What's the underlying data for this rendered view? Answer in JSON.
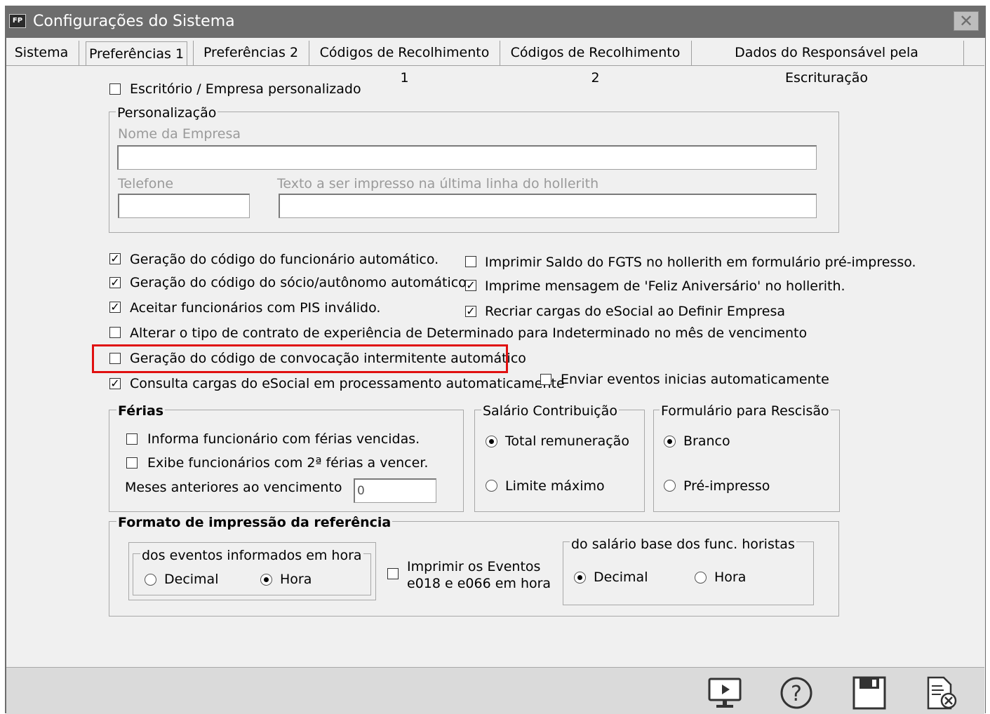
{
  "window": {
    "title": "Configurações do Sistema",
    "app_icon": "FP"
  },
  "tabs": [
    {
      "label": "Sistema"
    },
    {
      "label": "Preferências 1"
    },
    {
      "label": "Preferências 2"
    },
    {
      "label": "Códigos de Recolhimento 1"
    },
    {
      "label": "Códigos de Recolhimento 2"
    },
    {
      "label": "Dados do Responsável pela Escrituração"
    }
  ],
  "custom_company": {
    "checkbox_label": "Escritório / Empresa personalizado",
    "checked": false,
    "group_title": "Personalização",
    "company_name_label": "Nome da Empresa",
    "company_name_value": "",
    "phone_label": "Telefone",
    "phone_value": "",
    "payslip_text_label": "Texto a ser impresso na última linha do hollerith",
    "payslip_text_value": ""
  },
  "options_left": [
    {
      "label": "Geração do código do funcionário automático.",
      "checked": true
    },
    {
      "label": "Geração do código do sócio/autônomo automático.",
      "checked": true
    },
    {
      "label": "Aceitar funcionários com PIS inválido.",
      "checked": true
    },
    {
      "label": "Alterar o tipo de contrato de experiência de Determinado para Indeterminado no mês de vencimento",
      "checked": false
    },
    {
      "label": "Geração do código de convocação intermitente automático",
      "checked": false
    },
    {
      "label": "Consulta cargas do eSocial em processamento automaticamente",
      "checked": true
    }
  ],
  "options_right": [
    {
      "label": "Imprimir Saldo do FGTS no hollerith em formulário pré-impresso.",
      "checked": false
    },
    {
      "label": "Imprime mensagem de 'Feliz Aniversário' no hollerith.",
      "checked": true
    },
    {
      "label": "Recriar cargas do eSocial ao Definir Empresa",
      "checked": true
    },
    {
      "label": "Enviar eventos inicias automaticamente",
      "checked": false
    }
  ],
  "ferias": {
    "title": "Férias",
    "opt1": "Informa funcionário com férias vencidas.",
    "opt2": "Exibe funcionários com 2ª férias a vencer.",
    "months_label": "Meses anteriores ao vencimento",
    "months_value": "0"
  },
  "salario_contribuicao": {
    "title": "Salário Contribuição",
    "opt1": "Total remuneração",
    "opt2": "Limite máximo",
    "selected": "Total remuneração"
  },
  "formulario_rescisao": {
    "title": "Formulário para Rescisão",
    "opt1": "Branco",
    "opt2": "Pré-impresso",
    "selected": "Branco"
  },
  "formato": {
    "title": "Formato de impressão da referência",
    "hours_group_title": "dos eventos informados em hora",
    "hours_opt1": "Decimal",
    "hours_opt2": "Hora",
    "hours_selected": "Hora",
    "print_events_line1": "Imprimir os Eventos",
    "print_events_line2": "e018 e e066 em hora",
    "print_events_checked": false,
    "salary_group_title": "do salário base dos  func. horistas",
    "salary_opt1": "Decimal",
    "salary_opt2": "Hora",
    "salary_selected": "Decimal"
  },
  "toolbar": [
    "monitor-icon",
    "help-icon",
    "save-icon",
    "close-document-icon"
  ],
  "colors": {
    "titlebar": "#6d6d6d",
    "highlight": "#e01010",
    "window_bg": "#f0f0f0"
  }
}
